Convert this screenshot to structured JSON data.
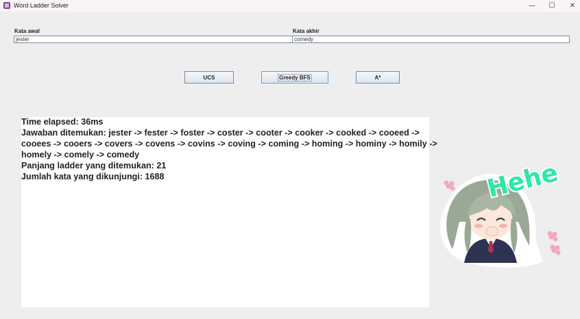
{
  "window": {
    "title": "Word Ladder Solver",
    "controls": {
      "minimize": "—",
      "maximize": "☐",
      "close": "✕"
    }
  },
  "form": {
    "start_word": {
      "label": "Kata awal",
      "value": "jester"
    },
    "end_word": {
      "label": "Kata akhir",
      "value": "comedy"
    }
  },
  "buttons": {
    "ucs": "UCS",
    "greedy_bfs": "Greedy BFS",
    "astar": "A*"
  },
  "result": {
    "lines": [
      "Time elapsed: 36ms",
      "Jawaban ditemukan: jester -> fester -> foster -> coster -> cooter -> cooker -> cooked -> cooeed ->",
      "cooees -> cooers -> covers -> covens -> covins -> coving -> coming -> homing -> hominy -> homily ->",
      "homely -> comely -> comedy",
      "Panjang ladder yang ditemukan: 21",
      "Jumlah kata yang dikunjungi: 1688"
    ]
  },
  "sticker": {
    "text": "Hehe",
    "icon": "anime-girl-sticker",
    "colors": {
      "text_fill": "#2ee8a6",
      "text_stroke": "#1aa474",
      "hair": "#9aa896",
      "flower": "#f4a7bd"
    }
  },
  "colors": {
    "background": "#eeeeee",
    "titlebar": "#fbf4f5",
    "input_border": "#7a8a99",
    "button_focus": "#6d9ccf"
  }
}
